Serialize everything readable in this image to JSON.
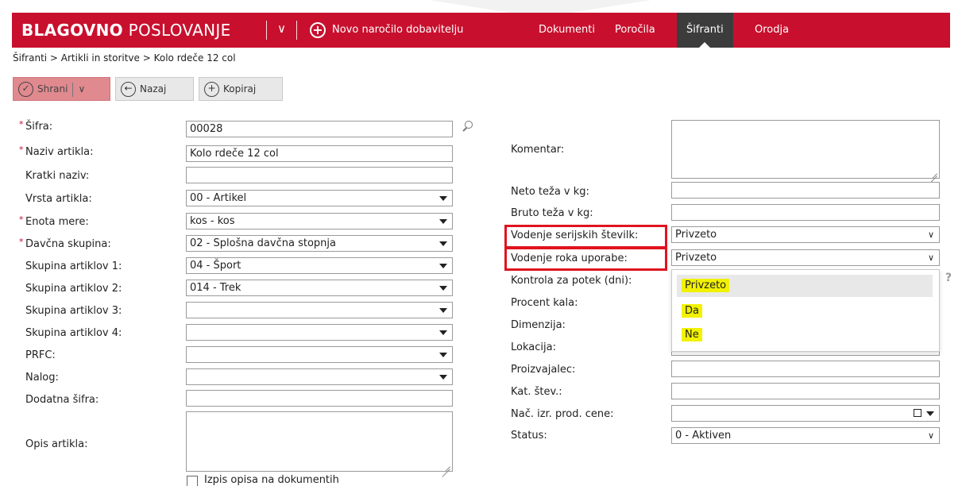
{
  "header": {
    "brand_bold": "BLAGOVNO",
    "brand_light": "POSLOVANJE",
    "new_order_label": "Novo naročilo dobavitelju",
    "menu": [
      "Dokumenti",
      "Poročila",
      "Šifranti",
      "Orodja"
    ],
    "active_menu": "Šifranti",
    "color": "#c8102e"
  },
  "breadcrumb": "Šifranti > Artikli in storitve > Kolo rdeče 12 col",
  "toolbar": {
    "save_label": "Shrani",
    "back_label": "Nazaj",
    "copy_label": "Kopiraj"
  },
  "left_form": {
    "sifra_label": "Šifra:",
    "sifra_value": "00028",
    "naziv_label": "Naziv artikla:",
    "naziv_value": "Kolo rdeče 12 col",
    "kratki_label": "Kratki naziv:",
    "kratki_value": "",
    "vrsta_label": "Vrsta artikla:",
    "vrsta_value": "00 - Artikel",
    "enota_label": "Enota mere:",
    "enota_value": "kos - kos",
    "davcna_label": "Davčna skupina:",
    "davcna_value": "02 - Splošna davčna stopnja",
    "sk1_label": "Skupina artiklov 1:",
    "sk1_value": "04 - Šport",
    "sk2_label": "Skupina artiklov 2:",
    "sk2_value": "014 - Trek",
    "sk3_label": "Skupina artiklov 3:",
    "sk3_value": "",
    "sk4_label": "Skupina artiklov 4:",
    "sk4_value": "",
    "prfc_label": "PRFC:",
    "prfc_value": "",
    "nalog_label": "Nalog:",
    "nalog_value": "",
    "dodatna_label": "Dodatna šifra:",
    "dodatna_value": "",
    "opis_label": "Opis artikla:",
    "opis_value": "",
    "izpis_label": "Izpis opisa na dokumentih"
  },
  "right_form": {
    "komentar_label": "Komentar:",
    "neto_label": "Neto teža v kg:",
    "bruto_label": "Bruto teža v kg:",
    "serijske_label": "Vodenje serijskih številk:",
    "serijske_value": "Privzeto",
    "rok_label": "Vodenje roka uporabe:",
    "rok_value": "Privzeto",
    "kontrola_label": "Kontrola za potek (dni):",
    "procent_label": "Procent kala:",
    "dimenzija_label": "Dimenzija:",
    "lokacija_label": "Lokacija:",
    "proizvajalec_label": "Proizvajalec:",
    "katstev_label": "Kat. štev.:",
    "nacizr_label": "Nač. izr. prod. cene:",
    "status_label": "Status:",
    "status_value": "0 - Aktiven"
  },
  "dropdown_options": [
    "Privzeto",
    "Da",
    "Ne"
  ],
  "help_icon": "?"
}
